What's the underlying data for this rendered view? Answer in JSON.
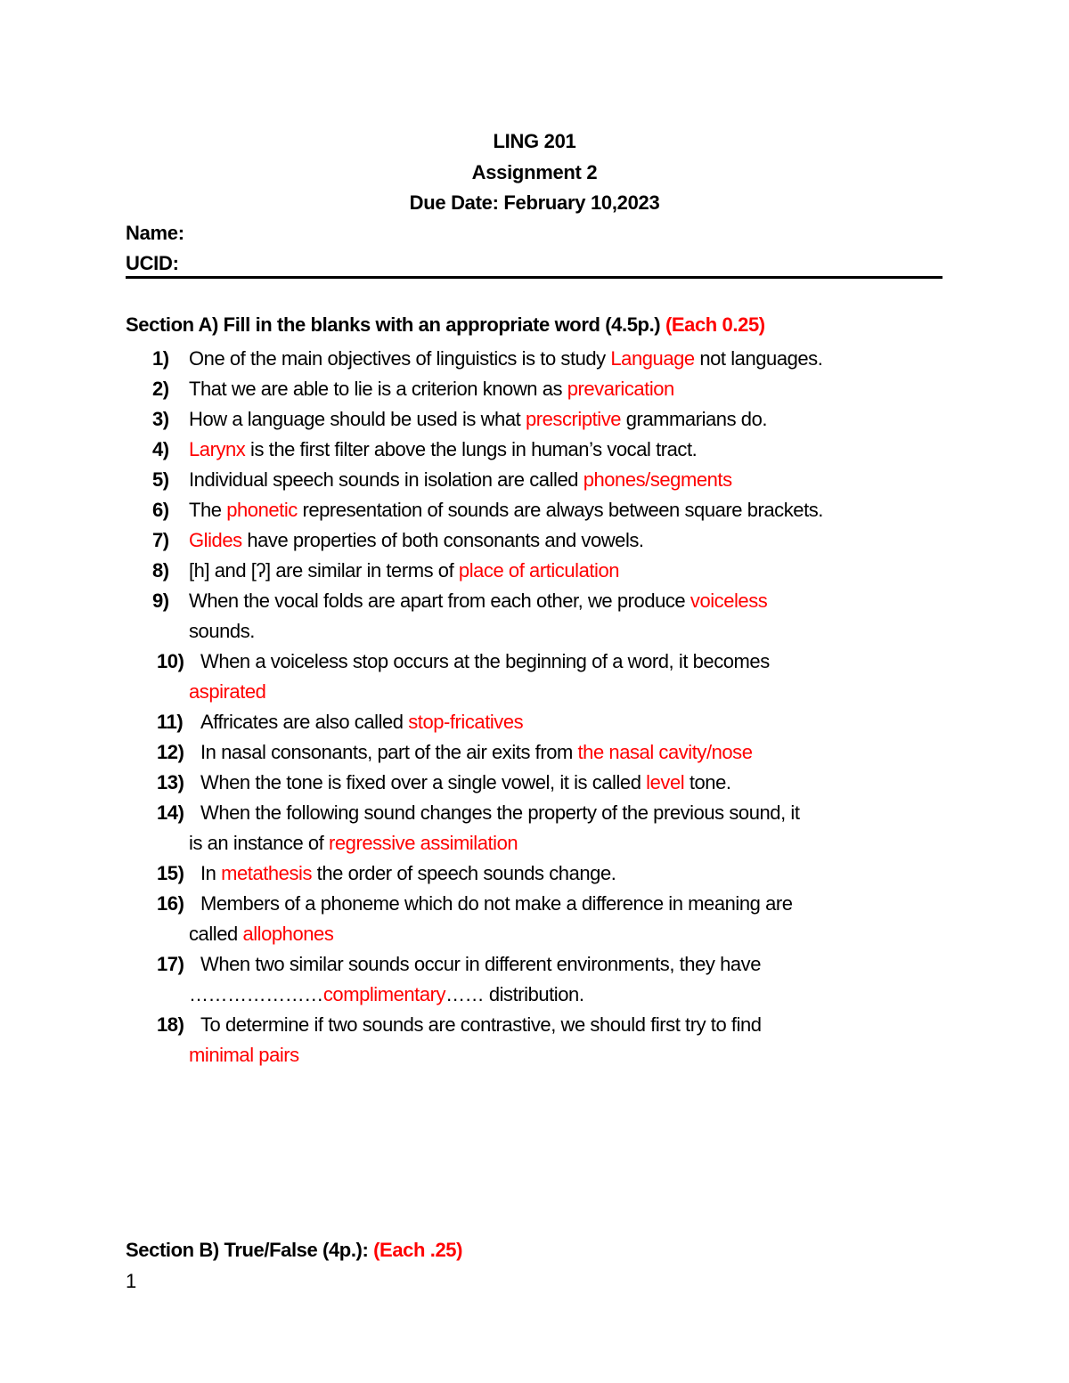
{
  "document": {
    "course": "LING 201",
    "assignment": "Assignment 2",
    "due_date": "Due Date: February 10,2023",
    "name_label": "Name:",
    "ucid_label": "UCID:",
    "accent_color": "#ff0000",
    "page_number": "1"
  },
  "section_a": {
    "title": "Section A) Fill in the blanks with an appropriate word (4.5p.) ",
    "points": "(Each 0.25)",
    "questions": [
      {
        "num": "1)",
        "before": "One of the main objectives of linguistics is to study ",
        "answer": "Language",
        "after": " not languages.",
        "cont_before": "",
        "cont_answer": "",
        "cont_after": ""
      },
      {
        "num": "2)",
        "before": "That we are able to lie is a criterion known as ",
        "answer": "prevarication",
        "after": "",
        "cont_before": "",
        "cont_answer": "",
        "cont_after": ""
      },
      {
        "num": "3)",
        "before": "How a language should be used is what ",
        "answer": "prescriptive",
        "after": " grammarians do.",
        "cont_before": "",
        "cont_answer": "",
        "cont_after": ""
      },
      {
        "num": "4)",
        "before": "",
        "answer": "Larynx",
        "after": " is the first filter above the lungs in human’s vocal tract.",
        "cont_before": "",
        "cont_answer": "",
        "cont_after": ""
      },
      {
        "num": "5)",
        "before": "Individual speech sounds in isolation are called ",
        "answer": "phones/segments",
        "after": "",
        "cont_before": "",
        "cont_answer": "",
        "cont_after": ""
      },
      {
        "num": "6)",
        "before": "The ",
        "answer": "phonetic",
        "after": " representation of sounds are always between square brackets.",
        "cont_before": "",
        "cont_answer": "",
        "cont_after": ""
      },
      {
        "num": "7)",
        "before": "",
        "answer": "Glides",
        "after": " have properties of both consonants and vowels.",
        "cont_before": "",
        "cont_answer": "",
        "cont_after": ""
      },
      {
        "num": "8)",
        "before": "[h] and [ʔ] are similar in terms of ",
        "answer": "place of articulation",
        "after": "",
        "cont_before": "",
        "cont_answer": "",
        "cont_after": ""
      },
      {
        "num": "9)",
        "before": "When the vocal folds are apart from each other, we produce ",
        "answer": "voiceless",
        "after": "",
        "cont_before": "sounds.",
        "cont_answer": "",
        "cont_after": ""
      },
      {
        "num": "10)",
        "before": "When a voiceless stop occurs at the beginning of a word, it becomes",
        "answer": "",
        "after": "",
        "cont_before": "",
        "cont_answer": "aspirated",
        "cont_after": ""
      },
      {
        "num": "11)",
        "before": "Affricates are also called ",
        "answer": "stop-fricatives",
        "after": "",
        "cont_before": "",
        "cont_answer": "",
        "cont_after": ""
      },
      {
        "num": "12)",
        "before": "In nasal consonants, part of the air exits from ",
        "answer": "the nasal cavity/nose",
        "after": "",
        "cont_before": "",
        "cont_answer": "",
        "cont_after": ""
      },
      {
        "num": "13)",
        "before": "When the tone is fixed over a single vowel, it is called ",
        "answer": "level",
        "after": " tone.",
        "cont_before": "",
        "cont_answer": "",
        "cont_after": ""
      },
      {
        "num": "14)",
        "before": "When the following sound changes the property of the previous sound, it",
        "answer": "",
        "after": "",
        "cont_before": "is an instance of ",
        "cont_answer": "regressive assimilation",
        "cont_after": ""
      },
      {
        "num": "15)",
        "before": "In ",
        "answer": "metathesis",
        "after": " the order of speech sounds change.",
        "cont_before": "",
        "cont_answer": "",
        "cont_after": ""
      },
      {
        "num": "16)",
        "before": "Members of a phoneme which do not make a difference in meaning are",
        "answer": "",
        "after": "",
        "cont_before": "called ",
        "cont_answer": "allophones",
        "cont_after": ""
      },
      {
        "num": "17)",
        "before": "When two similar sounds occur in different environments, they have",
        "answer": "",
        "after": "",
        "cont_before": "…………………",
        "cont_answer": "complimentary",
        "cont_after": "…… distribution."
      },
      {
        "num": "18)",
        "before": "To determine if two sounds are contrastive, we should first try to find",
        "answer": "",
        "after": "",
        "cont_before": "",
        "cont_answer": "minimal pairs",
        "cont_after": ""
      }
    ]
  },
  "section_b": {
    "title": "Section B) True/False (4p.): ",
    "points": "(Each .25)"
  }
}
